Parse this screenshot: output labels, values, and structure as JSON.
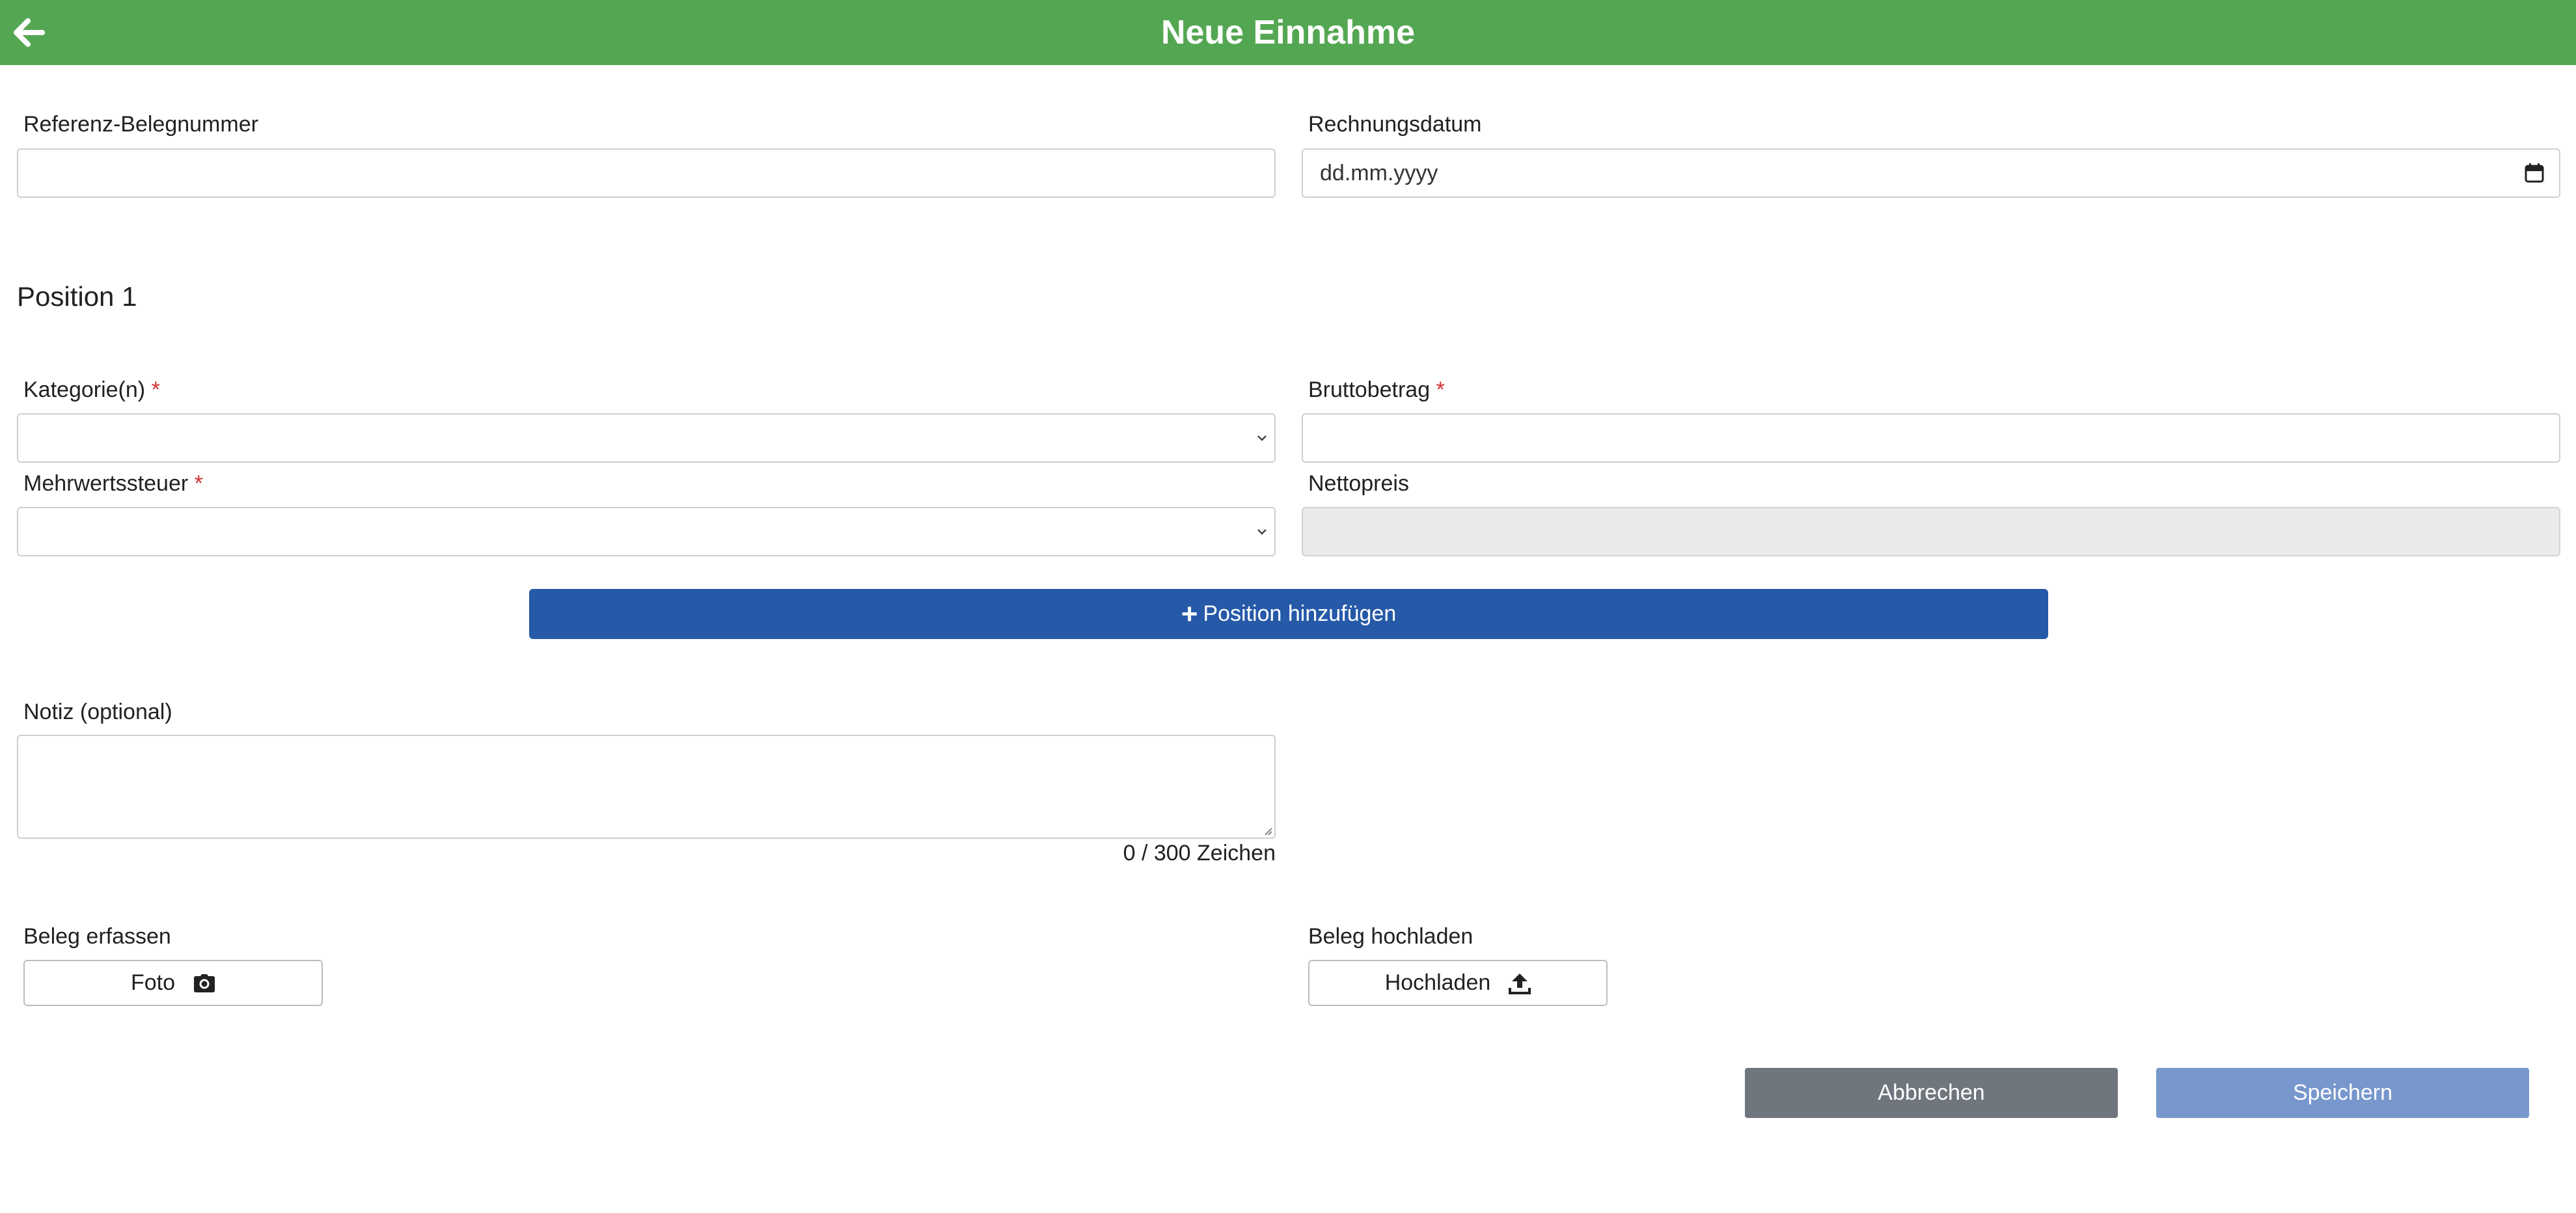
{
  "header": {
    "title": "Neue Einnahme",
    "back_icon": "arrow-left-icon",
    "bg_color": "#54a752"
  },
  "form": {
    "reference": {
      "label": "Referenz-Belegnummer",
      "value": ""
    },
    "invoice_date": {
      "label": "Rechnungsdatum",
      "placeholder": "dd.mm.yyyy",
      "icon": "calendar-icon"
    }
  },
  "position": {
    "title": "Position 1",
    "category": {
      "label": "Kategorie(n)",
      "required_mark": "*",
      "value": ""
    },
    "gross": {
      "label": "Bruttobetrag",
      "required_mark": "*",
      "value": ""
    },
    "vat": {
      "label": "Mehrwertssteuer",
      "required_mark": "*",
      "value": ""
    },
    "net": {
      "label": "Nettopreis",
      "value": ""
    }
  },
  "add_position": {
    "label": "Position hinzufügen",
    "icon": "plus-icon",
    "color": "#2659a8"
  },
  "note": {
    "label": "Notiz (optional)",
    "value": "",
    "counter": "0 / 300 Zeichen"
  },
  "capture": {
    "label": "Beleg erfassen",
    "button": "Foto",
    "icon": "camera-icon"
  },
  "upload": {
    "label": "Beleg hochladen",
    "button": "Hochladen",
    "icon": "upload-icon"
  },
  "actions": {
    "cancel": "Abbrechen",
    "save": "Speichern",
    "cancel_color": "#70767e",
    "save_color": "#7797cd"
  }
}
